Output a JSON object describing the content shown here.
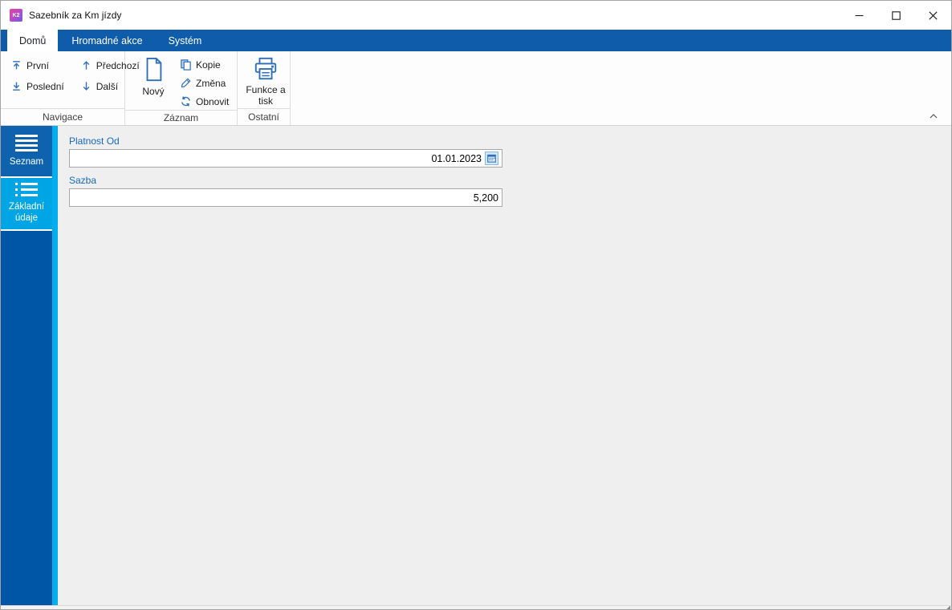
{
  "window": {
    "title": "Sazebník za Km jízdy",
    "logo_text": "K2"
  },
  "titlebar": {
    "buttons": [
      "minimize-icon",
      "maximize-icon",
      "close-icon"
    ]
  },
  "tabs": [
    {
      "label": "Domů",
      "active": true
    },
    {
      "label": "Hromadné akce",
      "active": false
    },
    {
      "label": "Systém",
      "active": false
    }
  ],
  "ribbon": {
    "groups": [
      {
        "label": "Navigace",
        "buttons": [
          {
            "label": "První",
            "icon": "first-icon"
          },
          {
            "label": "Poslední",
            "icon": "last-icon"
          },
          {
            "label": "Předchozí",
            "icon": "up-arrow-icon"
          },
          {
            "label": "Další",
            "icon": "down-arrow-icon"
          }
        ]
      },
      {
        "label": "Záznam",
        "buttons": [
          {
            "label": "Nový",
            "icon": "new-document-icon"
          },
          {
            "label": "Kopie",
            "icon": "copy-icon"
          },
          {
            "label": "Změna",
            "icon": "edit-pencil-icon"
          },
          {
            "label": "Obnovit",
            "icon": "refresh-icon"
          }
        ]
      },
      {
        "label": "Ostatní",
        "buttons": [
          {
            "label": "Funkce a tisk",
            "icon": "printer-icon"
          }
        ]
      }
    ]
  },
  "sidebar": {
    "items": [
      {
        "label": "Seznam",
        "icon": "hamburger-icon",
        "active": false
      },
      {
        "label": "Základní údaje",
        "icon": "detail-list-icon",
        "active": true
      }
    ]
  },
  "form": {
    "fields": [
      {
        "label": "Platnost Od",
        "value": "01.01.2023",
        "type": "date",
        "icon": "calendar-icon"
      },
      {
        "label": "Sazba",
        "value": "5,200",
        "type": "number"
      }
    ]
  },
  "colors": {
    "accent_blue": "#0e5caa",
    "sidebar_blue": "#0056a6",
    "sidebar_item_blue": "#0f63ae",
    "active_cyan": "#00a5e5",
    "strip_cyan": "#00aeef",
    "icon_blue": "#2e6fb7",
    "label_blue": "#1767be",
    "content_gray": "#efefef"
  }
}
